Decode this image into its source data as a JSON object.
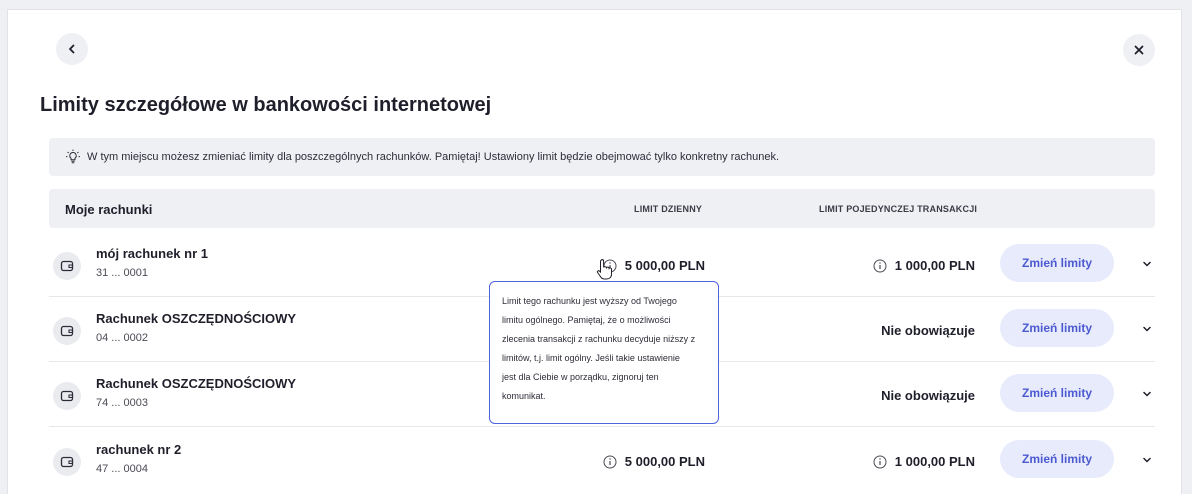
{
  "title": "Limity szczegółowe w bankowości internetowej",
  "info_text": "W tym miejscu możesz zmieniać limity dla poszczególnych rachunków. Pamiętaj! Ustawiony limit będzie obejmować tylko konkretny rachunek.",
  "table": {
    "header_accounts": "Moje rachunki",
    "header_daily": "LIMIT DZIENNY",
    "header_single": "LIMIT POJEDYNCZEJ TRANSAKCJI"
  },
  "accounts": [
    {
      "name": "mój rachunek nr 1",
      "number": "31 ... 0001",
      "daily_limit": "5 000,00 PLN",
      "single_limit": "1 000,00 PLN",
      "button": "Zmień limity"
    },
    {
      "name": "Rachunek OSZCZĘDNOŚCIOWY",
      "number": "04 ... 0002",
      "daily_limit": "",
      "single_limit": "Nie obowiązuje",
      "button": "Zmień limity"
    },
    {
      "name": "Rachunek OSZCZĘDNOŚCIOWY",
      "number": "74 ... 0003",
      "daily_limit": "",
      "single_limit": "Nie obowiązuje",
      "button": "Zmień limity"
    },
    {
      "name": "rachunek nr 2",
      "number": "47 ... 0004",
      "daily_limit": "5 000,00 PLN",
      "single_limit": "1 000,00 PLN",
      "button": "Zmień limity"
    }
  ],
  "tooltip_lines": [
    "Limit tego rachunku jest wyższy od Twojego",
    "limitu ogólnego. Pamiętaj, że o możliwości",
    "zlecenia transakcji z rachunku decyduje niższy z",
    "limitów, t.j. limit ogólny. Jeśli takie ustawienie",
    "jest dla Ciebie w porządku, zignoruj ten",
    "komunikat."
  ],
  "colors": {
    "accent": "#4b5ad1",
    "button_bg": "#e8ebfb",
    "panel_bg": "#eef0f4",
    "tooltip_border": "#4c63d9"
  }
}
